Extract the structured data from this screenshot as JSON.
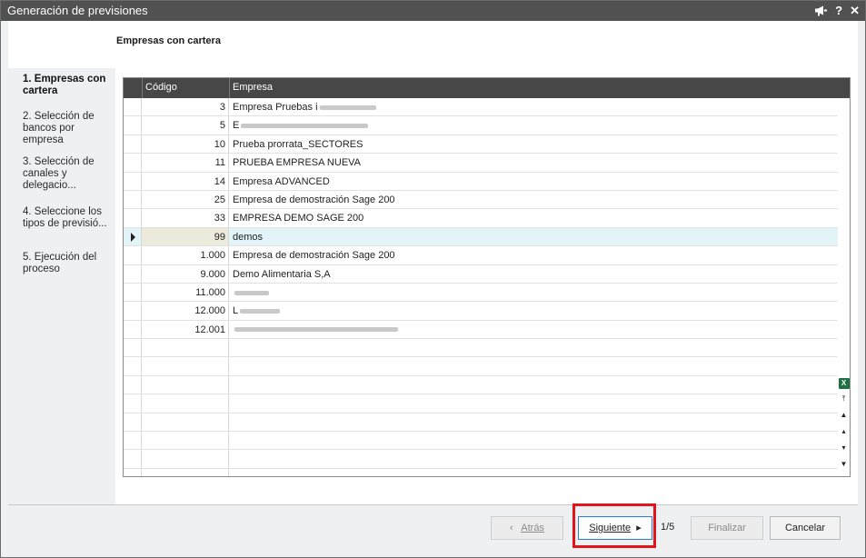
{
  "window": {
    "title": "Generación de previsiones"
  },
  "title_controls": {
    "help": "?",
    "close": "✕"
  },
  "header": {
    "section_title": "Empresas con cartera"
  },
  "steps": [
    {
      "label": "1. Empresas con cartera",
      "active": true
    },
    {
      "label": "2. Selección de bancos por empresa",
      "active": false
    },
    {
      "label": "3. Selección de canales y delegacio...",
      "active": false
    },
    {
      "label": "4. Seleccione los tipos de previsió...",
      "active": false
    },
    {
      "label": "5. Ejecución del proceso",
      "active": false
    }
  ],
  "grid": {
    "columns": [
      "Código",
      "Empresa"
    ],
    "rows": [
      {
        "code": "3",
        "empresa": "Empresa Pruebas i"
      },
      {
        "code": "5",
        "empresa": "E"
      },
      {
        "code": "10",
        "empresa": "Prueba prorrata_SECTORES"
      },
      {
        "code": "11",
        "empresa": "PRUEBA EMPRESA NUEVA"
      },
      {
        "code": "14",
        "empresa": "Empresa ADVANCED"
      },
      {
        "code": "25",
        "empresa": "Empresa de demostración Sage 200"
      },
      {
        "code": "33",
        "empresa": "EMPRESA DEMO SAGE 200"
      },
      {
        "code": "99",
        "empresa": "demos"
      },
      {
        "code": "1.000",
        "empresa": "Empresa de demostración Sage 200"
      },
      {
        "code": "9.000",
        "empresa": "Demo Alimentaria S,A"
      },
      {
        "code": "11.000",
        "empresa": ""
      },
      {
        "code": "12.000",
        "empresa": "L"
      },
      {
        "code": "12.001",
        "empresa": ""
      }
    ],
    "selected_code": "99"
  },
  "footer": {
    "back_label": "Atrás",
    "next_label": "Siguiente",
    "page_indicator": "1/5",
    "finish_label": "Finalizar",
    "cancel_label": "Cancelar"
  },
  "colors": {
    "titlebar": "#515151",
    "grid_header": "#474747",
    "selected_row": "#e3f4f9",
    "highlight": "#e1141c",
    "excel_green": "#1e7145"
  },
  "icons": {
    "title": [
      "megaphone-icon",
      "help-icon",
      "close-icon"
    ],
    "grid_side": [
      "excel-export-icon",
      "first-record-icon",
      "page-up-icon",
      "prev-record-icon",
      "next-record-icon",
      "page-down-icon",
      "last-record-icon"
    ],
    "footer": [
      "chevron-left-icon",
      "chevron-right-icon"
    ],
    "row": [
      "current-row-arrow-icon"
    ]
  }
}
